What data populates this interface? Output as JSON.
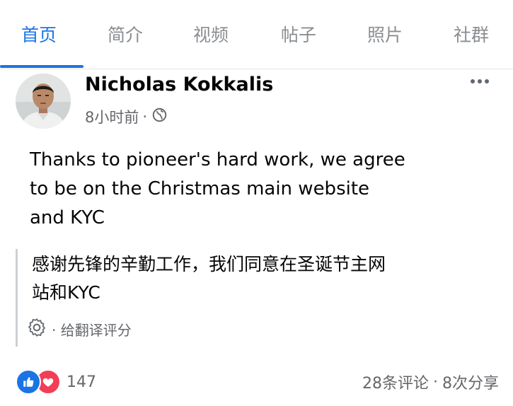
{
  "tabs": [
    {
      "label": "首页",
      "active": true
    },
    {
      "label": "简介"
    },
    {
      "label": "视频"
    },
    {
      "label": "帖子"
    },
    {
      "label": "照片"
    },
    {
      "label": "社群"
    }
  ],
  "post": {
    "author": "Nicholas Kokkalis",
    "time": "8小时前",
    "meta_separator": "·",
    "privacy_icon": "globe-icon",
    "text_lines": [
      "Thanks to pioneer's hard work, we agree",
      "to be on the Christmas main website",
      "and KYC"
    ],
    "translation_lines": [
      "感谢先锋的辛勤工作，我们同意在圣诞节主网",
      "站和KYC"
    ],
    "rate_translation": "· 给翻译评分"
  },
  "footer": {
    "reaction_icons": [
      "like-icon",
      "love-icon"
    ],
    "reaction_count": "147",
    "comments": "28条评论",
    "separator": "·",
    "shares": "8次分享"
  },
  "colors": {
    "accent": "#1b74e4",
    "love": "#f33e58",
    "secondary_text": "#65676b"
  }
}
